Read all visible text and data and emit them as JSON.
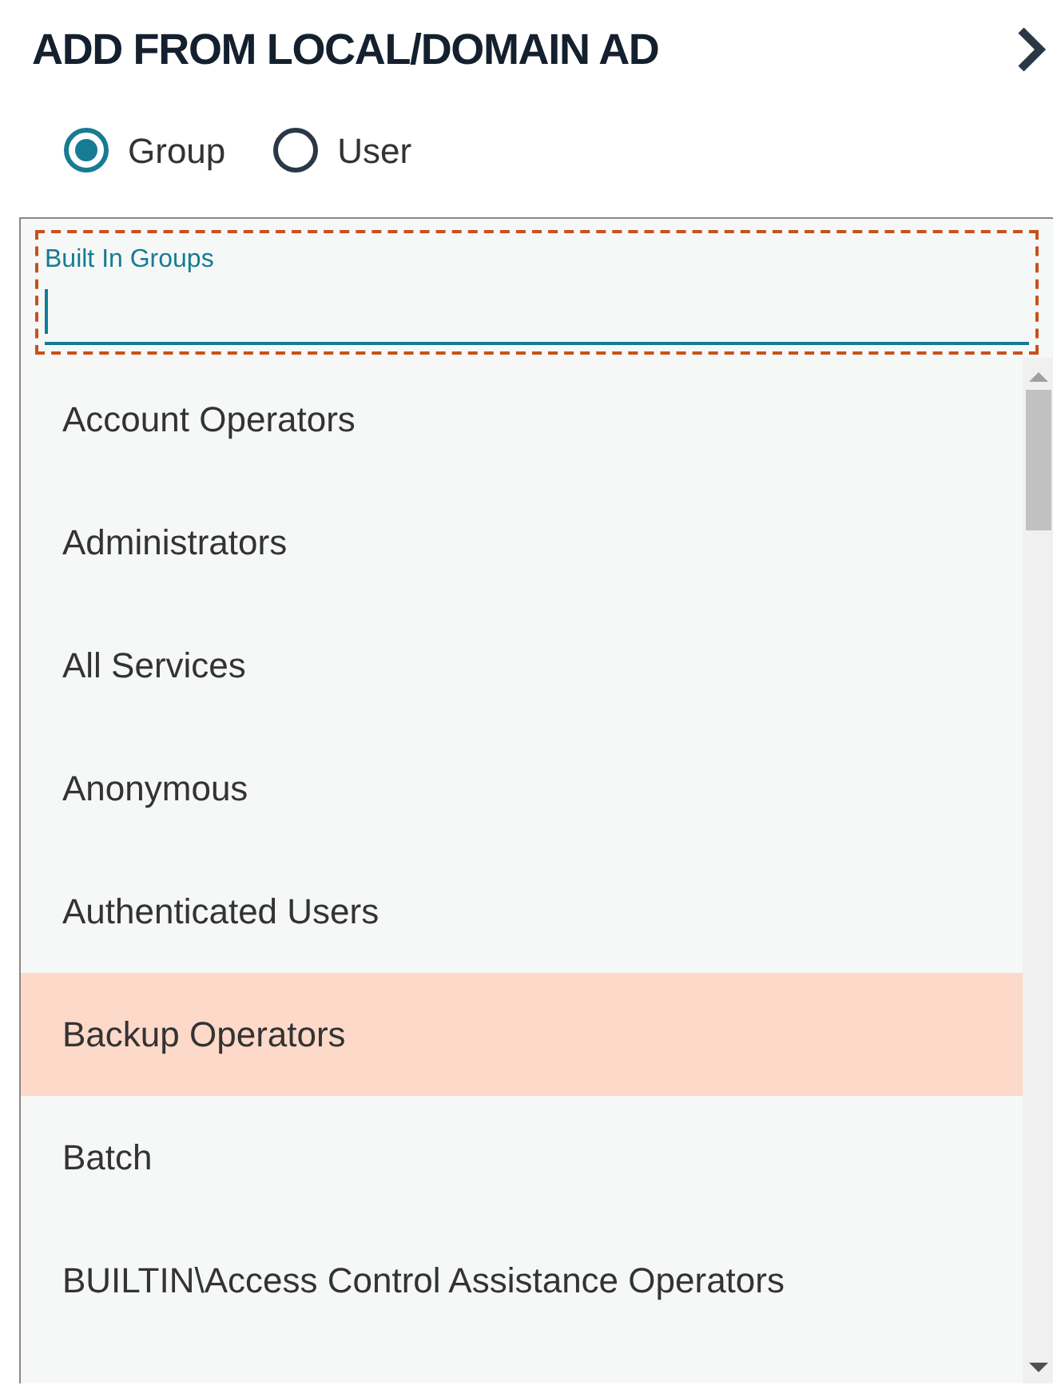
{
  "title": "ADD FROM LOCAL/DOMAIN AD",
  "type_options": [
    {
      "label": "Group",
      "selected": true
    },
    {
      "label": "User",
      "selected": false
    }
  ],
  "field": {
    "label": "Built In Groups",
    "focused": true
  },
  "items": [
    {
      "label": "Account Operators",
      "selected": false
    },
    {
      "label": "Administrators",
      "selected": false
    },
    {
      "label": "All Services",
      "selected": false
    },
    {
      "label": "Anonymous",
      "selected": false
    },
    {
      "label": "Authenticated Users",
      "selected": false
    },
    {
      "label": "Backup Operators",
      "selected": true
    },
    {
      "label": "Batch",
      "selected": false
    },
    {
      "label": "BUILTIN\\Access Control Assistance Operators",
      "selected": false
    }
  ]
}
